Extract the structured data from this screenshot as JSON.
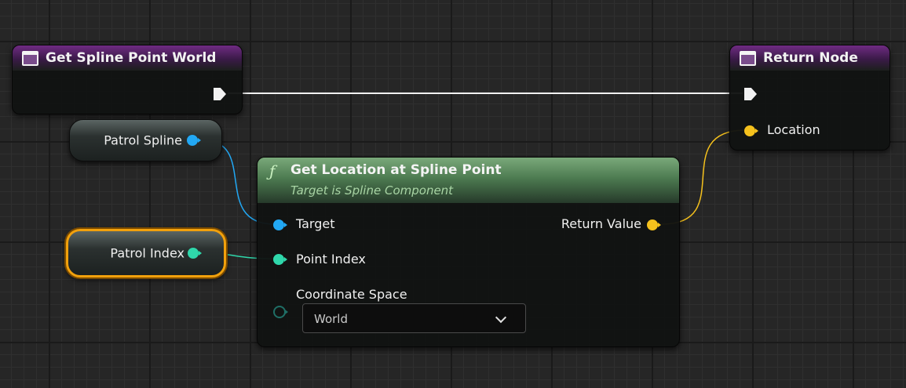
{
  "nodes": {
    "entry": {
      "title": "Get Spline Point World"
    },
    "return": {
      "title": "Return Node",
      "location_label": "Location"
    },
    "patrol_spline": {
      "label": "Patrol Spline"
    },
    "patrol_index": {
      "label": "Patrol Index"
    },
    "function": {
      "icon": "ƒ",
      "title": "Get Location at Spline Point",
      "subtitle": "Target is Spline Component",
      "target_label": "Target",
      "point_index_label": "Point Index",
      "coordinate_space_label": "Coordinate Space",
      "coordinate_space_value": "World",
      "return_value_label": "Return Value"
    }
  },
  "colors": {
    "object_pin": "#22a8f4",
    "integer_pin": "#2fd8ab",
    "vector_pin": "#f5c11d",
    "exec_wire": "#f2f2f2",
    "selection": "#f2a10c"
  },
  "icons": [
    "function-node-icon",
    "event-node-icon",
    "exec-pin-icon",
    "chevron-down-icon"
  ]
}
